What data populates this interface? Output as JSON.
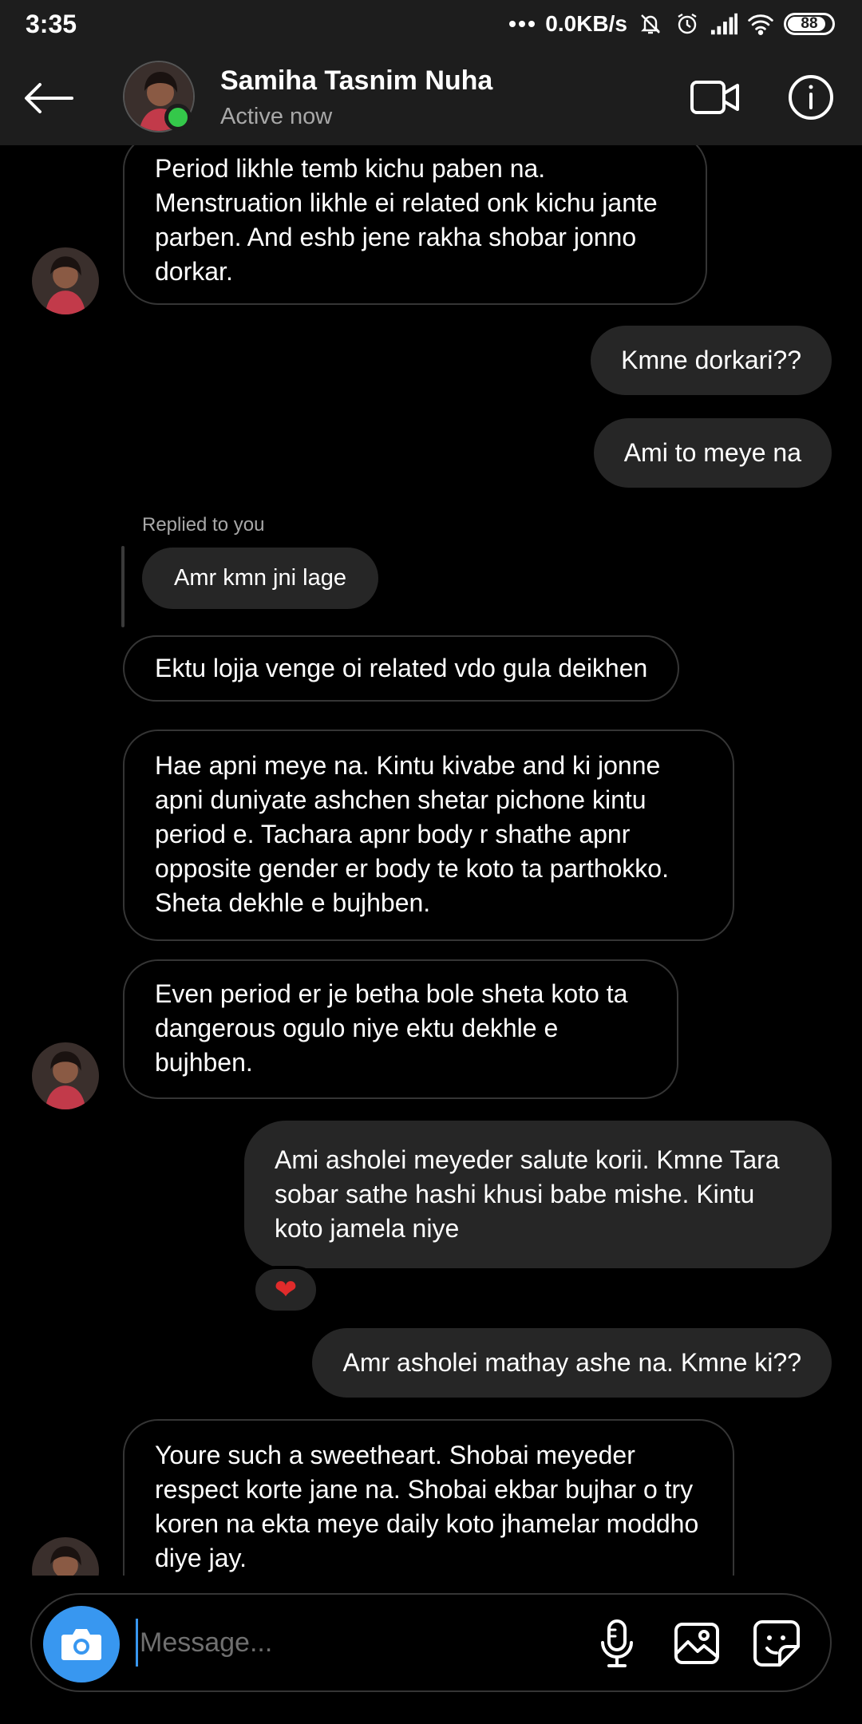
{
  "status_bar": {
    "time": "3:35",
    "net_speed": "0.0KB/s",
    "battery_level": 88,
    "battery_label": "88",
    "icons": [
      "dots-icon",
      "mute-bell-icon",
      "alarm-icon",
      "signal-icon",
      "wifi-icon",
      "battery-icon"
    ]
  },
  "header": {
    "name": "Samiha Tasnim Nuha",
    "status": "Active now",
    "online_color": "#34c84a",
    "icons": [
      "back-arrow-icon",
      "video-call-icon",
      "info-icon"
    ]
  },
  "messages": [
    {
      "direction": "incoming",
      "text": "Period likhle temb kichu paben na. Menstruation likhle ei related onk kichu jante parben. And eshb jene rakha shobar jonno dorkar."
    },
    {
      "direction": "outgoing",
      "text": "Kmne dorkari??"
    },
    {
      "direction": "outgoing",
      "text": "Ami to meye na"
    },
    {
      "direction": "incoming",
      "reply_label": "Replied to you",
      "quoted_text": "Amr kmn jni lage"
    },
    {
      "direction": "incoming",
      "text": "Ektu lojja venge oi related vdo gula deikhen"
    },
    {
      "direction": "incoming",
      "text": "Hae apni meye na. Kintu kivabe and ki jonne apni duniyate ashchen shetar pichone kintu period e. Tachara apnr body r shathe apnr opposite gender er body te koto ta parthokko. Sheta dekhle e bujhben."
    },
    {
      "direction": "incoming",
      "text": "Even period er je betha bole sheta koto ta dangerous ogulo niye ektu dekhle e bujhben."
    },
    {
      "direction": "outgoing",
      "text": "Ami asholei meyeder salute korii. Kmne Tara sobar sathe hashi khusi babe mishe. Kintu koto jamela niye",
      "reaction": "❤"
    },
    {
      "direction": "outgoing",
      "text": "Amr asholei mathay ashe na. Kmne ki??"
    },
    {
      "direction": "incoming",
      "text": "Youre such a sweetheart. Shobai meyeder respect korte jane na. Shobai ekbar bujhar o try koren na ekta meye daily koto jhamelar moddho diye jay."
    }
  ],
  "composer": {
    "placeholder": "Message...",
    "accent_color": "#3897f0",
    "icons": [
      "camera-icon",
      "microphone-icon",
      "gallery-icon",
      "sticker-icon"
    ]
  }
}
